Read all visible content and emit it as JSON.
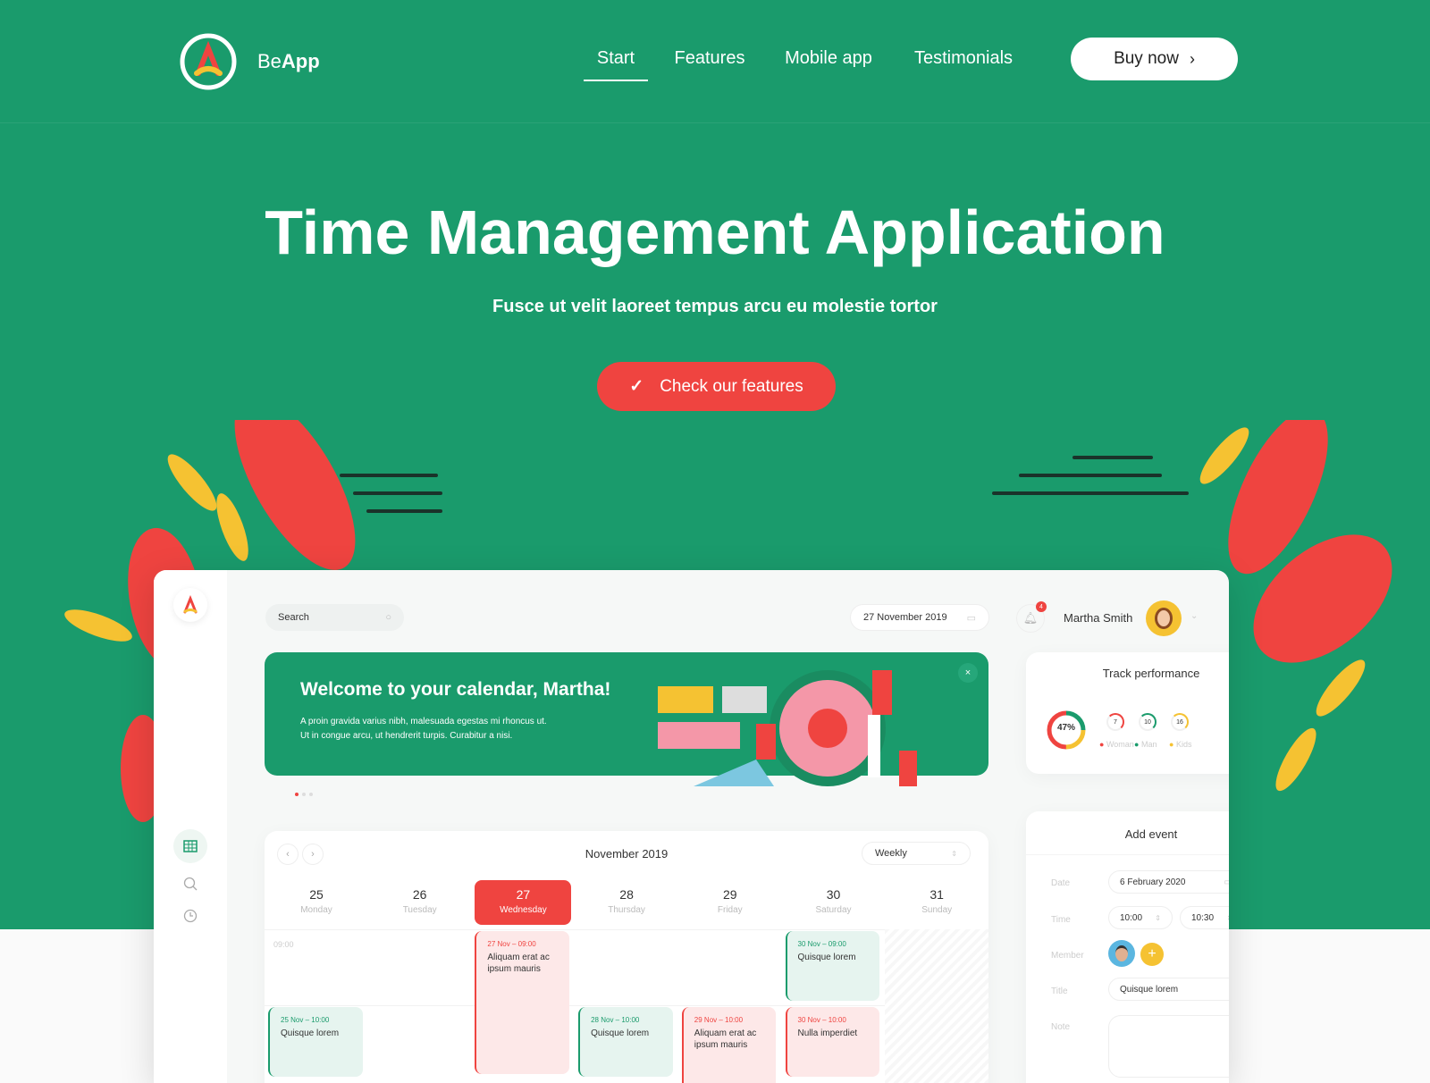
{
  "colors": {
    "brand_green": "#1a9b6c",
    "accent_red": "#ef4440",
    "yellow": "#f5c232"
  },
  "nav": {
    "brand_prefix": "Be",
    "brand_bold": "App",
    "items": [
      {
        "label": "Start",
        "active": true
      },
      {
        "label": "Features"
      },
      {
        "label": "Mobile app"
      },
      {
        "label": "Testimonials"
      }
    ],
    "buy_label": "Buy now",
    "buy_icon": "chevron-right-icon"
  },
  "hero": {
    "title": "Time Management Application",
    "subtitle": "Fusce ut velit laoreet tempus arcu eu molestie tortor",
    "cta_label": "Check our features",
    "cta_icon": "check-icon"
  },
  "app": {
    "search_placeholder": "Search",
    "date": "27 November 2019",
    "notifications": "4",
    "user": "Martha Smith",
    "banner": {
      "title": "Welcome to your calendar, Martha!",
      "line1": "A proin gravida varius nibh, malesuada egestas mi rhoncus ut.",
      "line2": "Ut in congue arcu, ut hendrerit turpis. Curabitur a nisi.",
      "close": "×",
      "slides": 3,
      "active_slide": 1
    },
    "calendar": {
      "month": "November 2019",
      "view": "Weekly",
      "time_label": "09:00",
      "days": [
        {
          "num": "25",
          "name": "Monday"
        },
        {
          "num": "26",
          "name": "Tuesday"
        },
        {
          "num": "27",
          "name": "Wednesday",
          "active": true
        },
        {
          "num": "28",
          "name": "Thursday"
        },
        {
          "num": "29",
          "name": "Friday"
        },
        {
          "num": "30",
          "name": "Saturday"
        },
        {
          "num": "31",
          "name": "Sunday"
        }
      ],
      "events": [
        {
          "time": "27 Nov – 09:00",
          "title": "Aliquam erat ac ipsum mauris",
          "color": "red"
        },
        {
          "time": "30 Nov – 09:00",
          "title": "Quisque lorem",
          "color": "green"
        },
        {
          "time": "25 Nov – 10:00",
          "title": "Quisque lorem",
          "color": "green"
        },
        {
          "time": "28 Nov – 10:00",
          "title": "Quisque lorem",
          "color": "green"
        },
        {
          "time": "29 Nov – 10:00",
          "title": "Aliquam erat ac ipsum mauris",
          "color": "red"
        },
        {
          "time": "30 Nov – 10:00",
          "title": "Nulla imperdiet",
          "color": "red"
        }
      ]
    },
    "track": {
      "title": "Track performance",
      "total_percent": "47%",
      "stats": [
        {
          "value": "7",
          "label": "Woman",
          "color": "#ef4440"
        },
        {
          "value": "10",
          "label": "Man",
          "color": "#1a9b6c"
        },
        {
          "value": "16",
          "label": "Kids",
          "color": "#f5c232"
        }
      ]
    },
    "add_event": {
      "title": "Add event",
      "date_label": "Date",
      "date": "6 February 2020",
      "time_label": "Time",
      "time_from": "10:00",
      "time_to": "10:30",
      "member_label": "Member",
      "add_member": "+",
      "title_label": "Title",
      "title_value": "Quisque lorem",
      "note_label": "Note"
    }
  }
}
